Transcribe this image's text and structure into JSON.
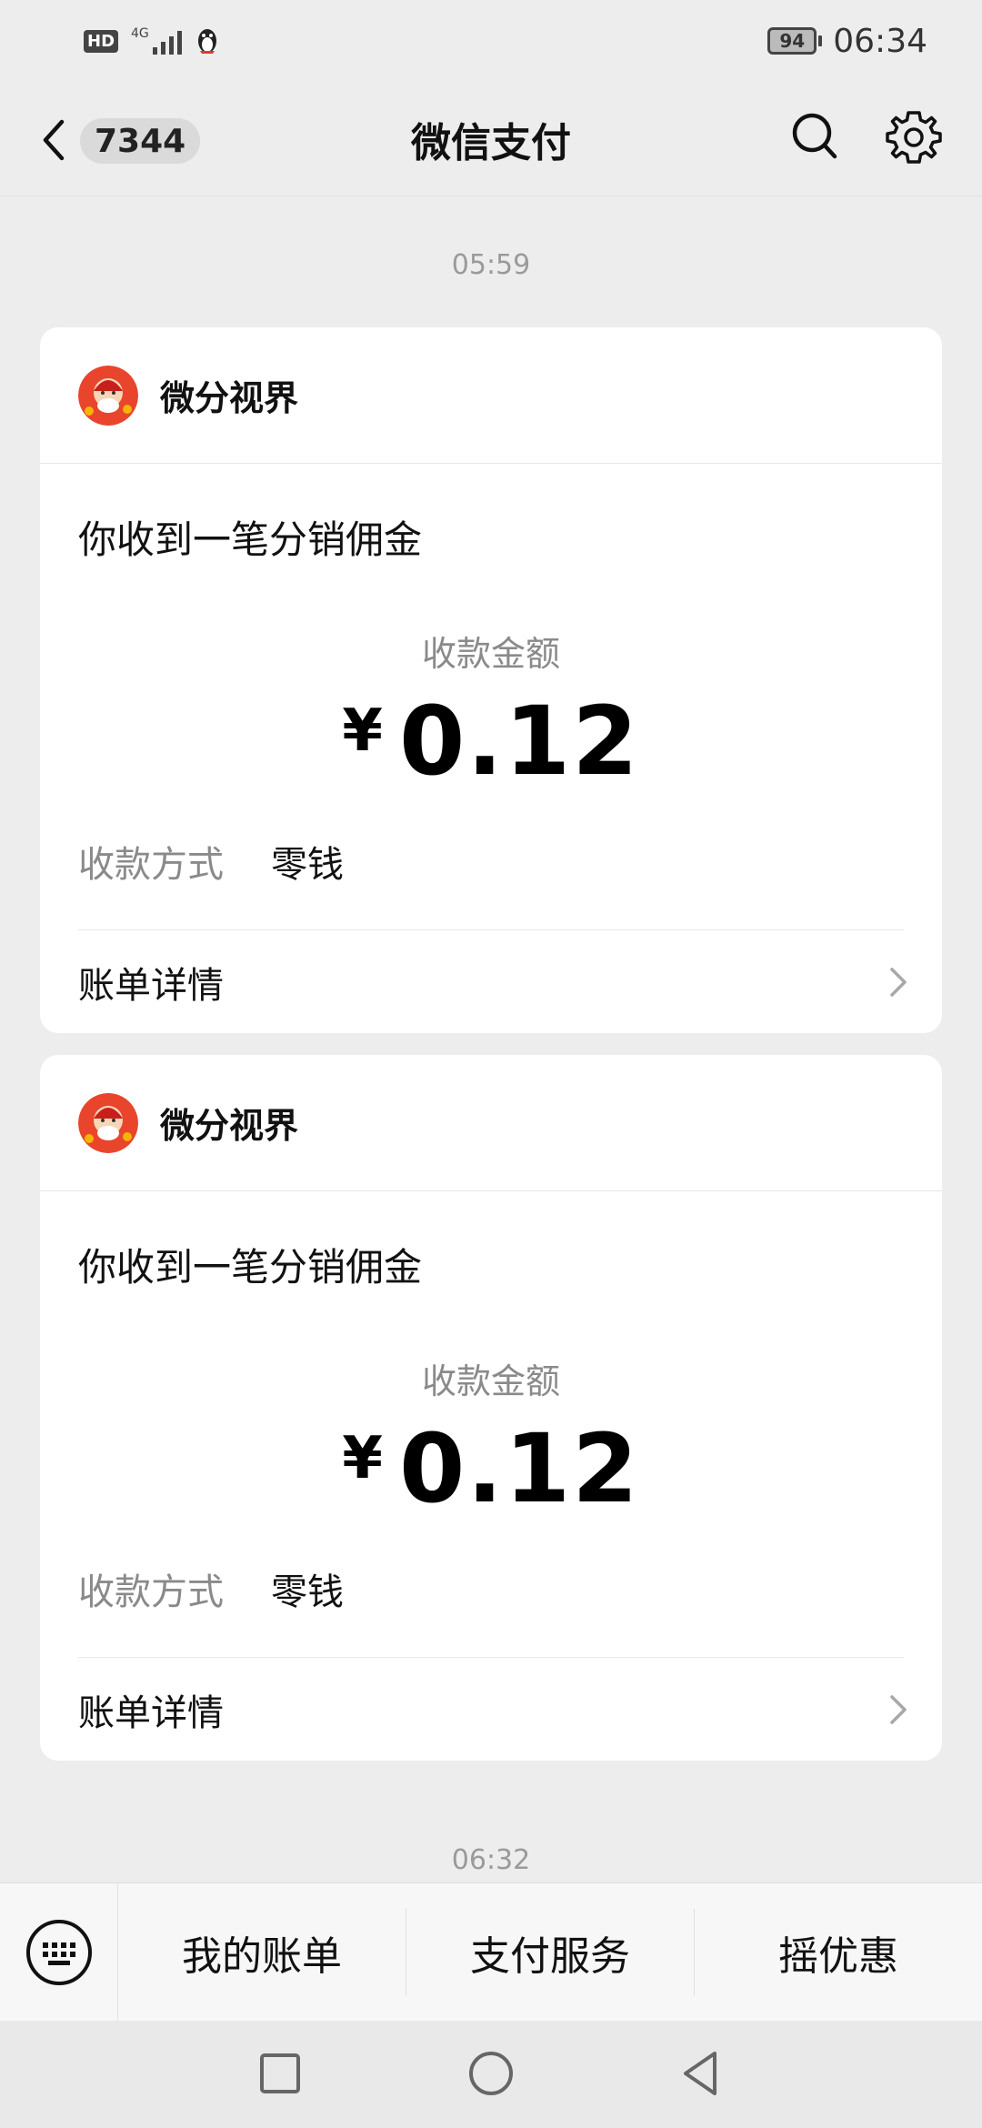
{
  "status_bar": {
    "hd_label": "HD",
    "network_label": "4G",
    "battery_level": "94",
    "time": "06:34",
    "app_icon": "qq-penguin-icon"
  },
  "nav": {
    "unread_count": "7344",
    "title": "微信支付"
  },
  "messages": [
    {
      "time": "05:59",
      "merchant": "微分视界",
      "title": "你收到一笔分销佣金",
      "amount_label": "收款金额",
      "currency": "¥",
      "amount": "0.12",
      "method_label": "收款方式",
      "method_value": "零钱",
      "detail_label": "账单详情"
    },
    {
      "merchant": "微分视界",
      "title": "你收到一笔分销佣金",
      "amount_label": "收款金额",
      "currency": "¥",
      "amount": "0.12",
      "method_label": "收款方式",
      "method_value": "零钱",
      "detail_label": "账单详情"
    }
  ],
  "next_time": "06:32",
  "bottom_menu": {
    "items": [
      "我的账单",
      "支付服务",
      "摇优惠"
    ]
  },
  "colors": {
    "background": "#ededed",
    "card": "#ffffff",
    "muted_text": "#8a8a8a"
  }
}
